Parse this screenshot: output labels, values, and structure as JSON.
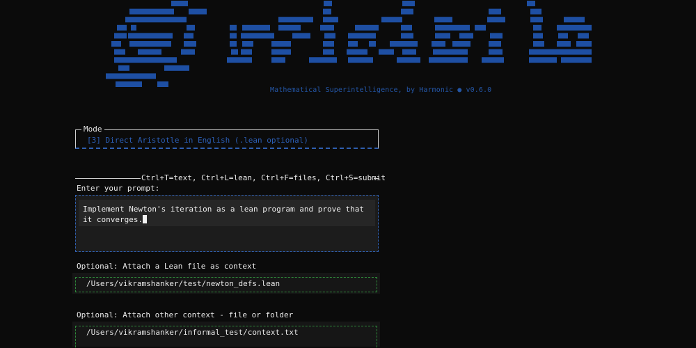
{
  "header": {
    "logo_text": "aristotle",
    "tagline": "Mathematical Superintelligence, by Harmonic ● v0.6.0",
    "logo_color": "#1e4fa3"
  },
  "mode": {
    "label": "Mode",
    "value": "[3] Direct Aristotle in English (.lean optional)"
  },
  "prompt": {
    "shortcuts_hint": "Ctrl+T=text, Ctrl+L=lean, Ctrl+F=files, Ctrl+S=submit",
    "label": "Enter your prompt:",
    "value": "Implement Newton's iteration as a lean program and prove that it converges."
  },
  "lean_attachment": {
    "label": "Optional: Attach a Lean file as context",
    "value": "/Users/vikramshanker/test/newton_defs.lean"
  },
  "other_attachment": {
    "label": "Optional: Attach other context - file or folder",
    "value": "/Users/vikramshanker/informal_test/context.txt"
  },
  "colors": {
    "accent_blue": "#2c5fb6",
    "field_green": "#2f8a3a",
    "background": "#0b0b0b"
  }
}
